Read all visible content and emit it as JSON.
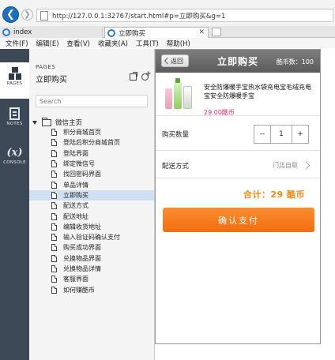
{
  "browser": {
    "url": "http://127.0.0.1:32767/start.html#p=立即购买&g=1",
    "tabs": [
      {
        "label": "index",
        "active": false
      },
      {
        "label": "立即购买",
        "active": true
      }
    ],
    "menu": [
      "文件(F)",
      "编辑(E)",
      "查看(V)",
      "收藏夹(A)",
      "工具(T)",
      "帮助(H)"
    ]
  },
  "rail": {
    "pages_label": "PAGES",
    "notes_label": "NOTES",
    "console_label": "CONSOLE",
    "console_glyph": "(x)"
  },
  "panel": {
    "section": "PAGES",
    "title": "立即购买",
    "search_placeholder": "Search",
    "root": "微信主页",
    "pages": [
      "积分商城首页",
      "登陆后积分商城首页",
      "登陆界面",
      "绑定微信号",
      "找回密码界面",
      "单品详情",
      "立即购买",
      "配送方式",
      "配送地址",
      "编辑收货地址",
      "输入验证码确认支付",
      "购买成功界面",
      "兑换物品界面",
      "兑换物品详情",
      "客服界面",
      "如何赚酷币"
    ],
    "selected_page": "立即购买"
  },
  "prototype": {
    "back_label": "返回",
    "title": "立即购买",
    "coin_count": "酷币数：100",
    "product_name": "安全防爆暖手宝热水袋充电宝毛绒充电宝安全防爆暖手宝",
    "product_price": "29.00酷币",
    "qty_label": "购买数量",
    "qty_minus": "--",
    "qty_value": "1",
    "qty_plus": "+",
    "ship_label": "配送方式",
    "ship_value": "门店自取",
    "total": "合计：29 酷币",
    "pay_label": "确认支付",
    "colors": {
      "accent": "#f26d10",
      "price": "#e0286e",
      "total": "#f08a13"
    }
  }
}
